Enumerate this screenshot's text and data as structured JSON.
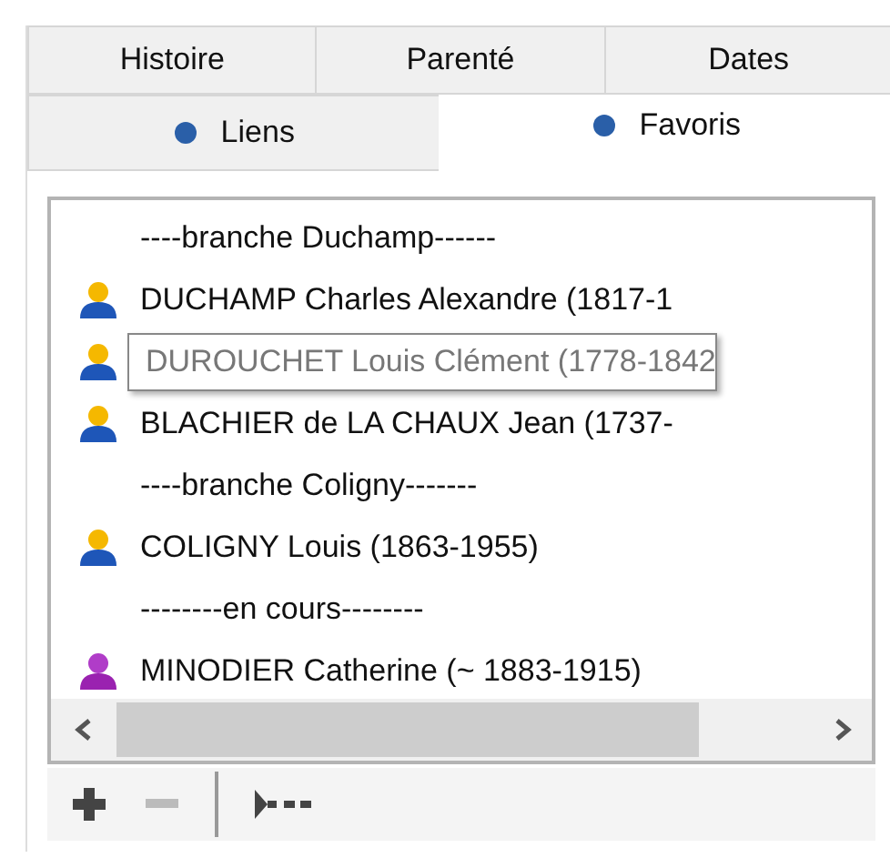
{
  "tab_rows": [
    [
      {
        "label": "Histoire",
        "kind": "plain",
        "selected": false
      },
      {
        "label": "Parenté",
        "kind": "plain",
        "selected": false
      },
      {
        "label": "Dates",
        "kind": "plain",
        "selected": false
      }
    ],
    [
      {
        "label": "Liens",
        "kind": "dot",
        "selected": false
      },
      {
        "label": "Favoris",
        "kind": "dot",
        "selected": true
      }
    ]
  ],
  "favorites": [
    {
      "kind": "separator",
      "text": "----branche Duchamp------",
      "hovered": false
    },
    {
      "kind": "male",
      "text": "DUCHAMP Charles Alexandre (1817-1",
      "hovered": false
    },
    {
      "kind": "male",
      "text": "DUROUCHET Louis Clément (1778-1842",
      "hovered": true
    },
    {
      "kind": "male",
      "text": "BLACHIER de LA CHAUX Jean (1737-",
      "hovered": false
    },
    {
      "kind": "separator",
      "text": "----branche Coligny-------",
      "hovered": false
    },
    {
      "kind": "male",
      "text": "COLIGNY Louis (1863-1955)",
      "hovered": false
    },
    {
      "kind": "separator",
      "text": "--------en cours--------",
      "hovered": false
    },
    {
      "kind": "female",
      "text": "MINODIER Catherine (~ 1883-1915)",
      "hovered": false
    }
  ],
  "toolbar": [
    {
      "kind": "add",
      "disabled": false
    },
    {
      "kind": "remove",
      "disabled": true
    },
    {
      "kind": "divider"
    },
    {
      "kind": "link",
      "disabled": false
    }
  ]
}
